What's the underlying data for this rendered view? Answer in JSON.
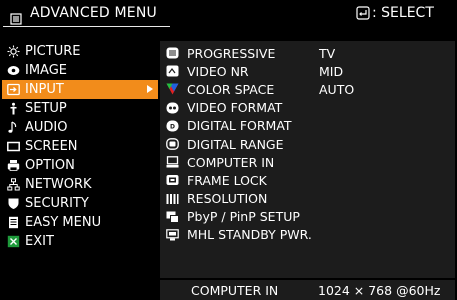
{
  "header": {
    "title": "ADVANCED MENU",
    "select_label": ": SELECT"
  },
  "menu": {
    "items": [
      {
        "label": "PICTURE",
        "icon": "sun-icon"
      },
      {
        "label": "IMAGE",
        "icon": "image-icon"
      },
      {
        "label": "INPUT",
        "icon": "input-icon",
        "active": true
      },
      {
        "label": "SETUP",
        "icon": "setup-icon"
      },
      {
        "label": "AUDIO",
        "icon": "audio-icon"
      },
      {
        "label": "SCREEN",
        "icon": "screen-icon"
      },
      {
        "label": "OPTION",
        "icon": "option-icon"
      },
      {
        "label": "NETWORK",
        "icon": "network-icon"
      },
      {
        "label": "SECURITY",
        "icon": "security-icon"
      },
      {
        "label": "EASY MENU",
        "icon": "easy-menu-icon"
      },
      {
        "label": "EXIT",
        "icon": "exit-icon"
      }
    ]
  },
  "submenu": {
    "items": [
      {
        "label": "PROGRESSIVE",
        "value": "TV",
        "icon": "progressive-icon"
      },
      {
        "label": "VIDEO NR",
        "value": "MID",
        "icon": "video-nr-icon"
      },
      {
        "label": "COLOR SPACE",
        "value": "AUTO",
        "icon": "color-space-icon"
      },
      {
        "label": "VIDEO FORMAT",
        "value": "",
        "icon": "video-format-icon"
      },
      {
        "label": "DIGITAL FORMAT",
        "value": "",
        "icon": "digital-format-icon"
      },
      {
        "label": "DIGITAL RANGE",
        "value": "",
        "icon": "digital-range-icon"
      },
      {
        "label": "COMPUTER IN",
        "value": "",
        "icon": "computer-in-icon"
      },
      {
        "label": "FRAME LOCK",
        "value": "",
        "icon": "frame-lock-icon"
      },
      {
        "label": "RESOLUTION",
        "value": "",
        "icon": "resolution-icon"
      },
      {
        "label": "PbyP / PinP SETUP",
        "value": "",
        "icon": "pbyp-icon"
      },
      {
        "label": "MHL STANDBY PWR.",
        "value": "",
        "icon": "mhl-icon"
      }
    ]
  },
  "footer": {
    "source": "COMPUTER IN",
    "signal": "1024 × 768 @60Hz"
  },
  "colors": {
    "highlight": "#f28c1b",
    "panel": "#1c1c1c",
    "background": "#000000"
  }
}
